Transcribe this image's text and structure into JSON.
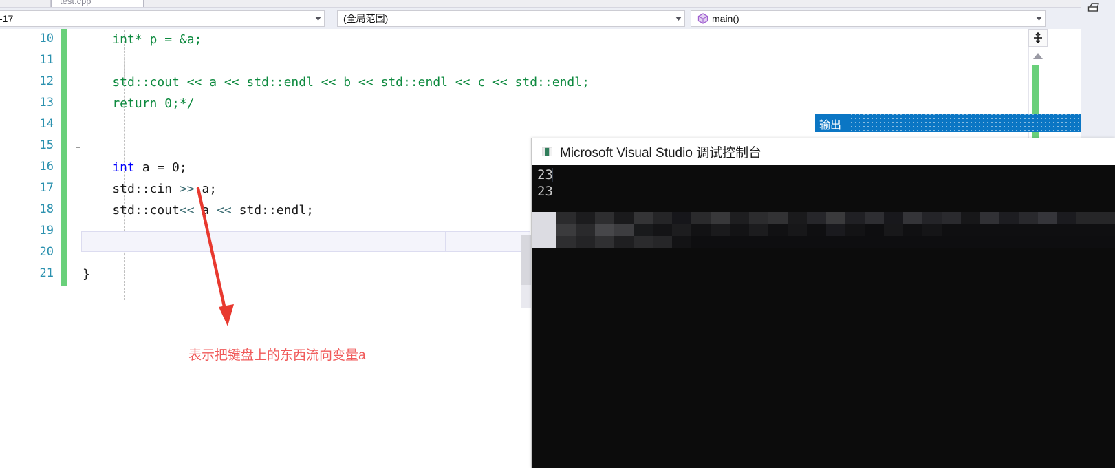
{
  "window": {
    "tab_label": "test.cpp",
    "top_right_icon": "pin-window-icon"
  },
  "navbar": {
    "scope_dropdown_value": "-17",
    "global_scope_value": "(全局范围)",
    "function_value": "main()",
    "function_icon": "method-cube-icon",
    "dropdown_arrow_icon": "chevron-down-icon"
  },
  "editor": {
    "line_numbers": [
      "10",
      "11",
      "12",
      "13",
      "14",
      "15",
      "16",
      "17",
      "18",
      "19",
      "20",
      "21"
    ],
    "lines": [
      {
        "num": "10",
        "segments": [
          {
            "text": "    int* p = &a;",
            "kind": "comment"
          }
        ]
      },
      {
        "num": "11",
        "segments": [
          {
            "text": "",
            "kind": "comment"
          }
        ]
      },
      {
        "num": "12",
        "segments": [
          {
            "text": "    std::cout << a << std::endl << b << std::endl << c << std::endl;",
            "kind": "comment"
          }
        ]
      },
      {
        "num": "13",
        "segments": [
          {
            "text": "    return 0;*/",
            "kind": "comment"
          }
        ]
      },
      {
        "num": "14",
        "segments": [
          {
            "text": "",
            "kind": "plain"
          }
        ]
      },
      {
        "num": "15",
        "segments": [
          {
            "text": "",
            "kind": "plain"
          }
        ]
      },
      {
        "num": "16",
        "segments": [
          {
            "text": "    int",
            "kind": "kw"
          },
          {
            "text": " a = 0;",
            "kind": "plain"
          }
        ]
      },
      {
        "num": "17",
        "segments": [
          {
            "text": "    std::cin ",
            "kind": "plain"
          },
          {
            "text": ">>",
            "kind": "op"
          },
          {
            "text": " a;",
            "kind": "plain"
          }
        ]
      },
      {
        "num": "18",
        "segments": [
          {
            "text": "    std::cout",
            "kind": "plain"
          },
          {
            "text": "<<",
            "kind": "op"
          },
          {
            "text": " a ",
            "kind": "plain"
          },
          {
            "text": "<<",
            "kind": "op"
          },
          {
            "text": " std::endl;",
            "kind": "plain"
          }
        ]
      },
      {
        "num": "19",
        "segments": [
          {
            "text": "",
            "kind": "plain"
          }
        ]
      },
      {
        "num": "20",
        "segments": [
          {
            "text": "",
            "kind": "plain"
          }
        ]
      },
      {
        "num": "21",
        "segments": [
          {
            "text": "}",
            "kind": "plain"
          }
        ]
      }
    ],
    "current_line": "18",
    "annotation_text": "表示把键盘上的东西流向变量a",
    "annotation_color": "#f05a5a",
    "change_bar_color": "#69d07a",
    "split_icon": "split-view-icon",
    "scroll_up_icon": "scroll-up-arrow-icon",
    "scrollbar_marker_color": "#69d07a"
  },
  "output_panel": {
    "label": "输出",
    "accent_color": "#0b76c4"
  },
  "console": {
    "title": "Microsoft Visual Studio 调试控制台",
    "icon": "console-app-icon",
    "lines": [
      "23",
      "23"
    ],
    "background_color": "#0c0c0c",
    "text_color": "#c8c8c8"
  }
}
